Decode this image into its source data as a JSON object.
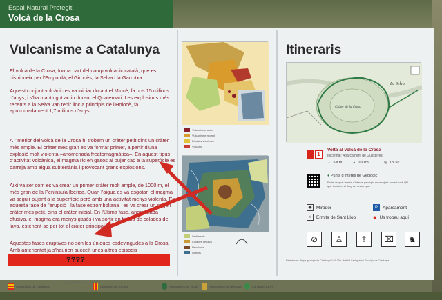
{
  "header": {
    "subtitle": "Espai Natural Protegit",
    "title": "Volcà de la Crosa"
  },
  "left": {
    "heading": "Vulcanisme a Catalunya",
    "p1": "El volcà de la Crosa, forma part del camp volcànic català, que es distribueix per l'Empordà, el Gironès, la Selva i la Garrotxa.",
    "p2": "Aquest conjunt volcànic es va iniciar durant el Miocè, fa uns 15 milions d'anys, i s'ha mantingut actiu durant el Quaternari. Les explosions més recents a la Selva van tenir lloc a principis de l'Holocè, fa aproximadament 1,7 milions d'anys.",
    "p3": "A l'interior del volcà de la Crosa hi trobem un cràter petit dins un cràter més ample. El cràter més gran es va formar primer, a partir d'una explosió molt violenta –anomenada freatomagmàtica–. En aquest tipus d'activitat volcànica, el magma ric en gasos al pujar cap a la superfície es barreja amb aigua subterrània i provocant grans explosions.",
    "p4": "Així va ser com es va crear un primer cràter molt ample, de 1000 m, el més gran de la Península Ibèrica. Quan l'aigua es va esgotar, el magma va seguir pujant a la superfície però amb una activitat menys violenta. En aquesta fase de l'erupció –la fase estromboliana– es va crear un segon cràter més petit, dins el cràter inicial. En l'última fase, anomenada efusiva, el magma era menys gasós i va sortir en forma de colades de lava, estenent-se per tot el cràter principal.",
    "p5": "Aquestes fases eruptives no són les úniques esdevingudes a la Crosa. Amb anterioritat ja s'haurien succeït unes altres episodis",
    "redbar_text": "????"
  },
  "maps": {
    "legend1": [
      "Vulcanisme antic",
      "Vulcanisme recent",
      "Dipòsits volcànics",
      "Volcans"
    ],
    "legend2": [
      "Sediments",
      "Colades de lava",
      "Piroclasts",
      "Granits"
    ]
  },
  "right": {
    "heading": "Itineraris",
    "map_labels": [
      "La Selva",
      "Cràter de la Crosa"
    ],
    "route_number": "1",
    "route_title": "Volta al volcà de la Crosa",
    "route_sub": "Inici/final: Aparcament de Guilsterés",
    "stats": [
      "5 Km",
      "100 m",
      "1h 30'"
    ],
    "geo_label": "Punts d'Interès de Geològic",
    "geo_text": "Podeu seguir la ruta d'interès geològic escanejant aquest codi QR que trobareu al llarg del recorregut.",
    "poi": {
      "mirador": "Mirador",
      "ermita": "Ermita de Sant Llop",
      "aparcament": "Aparcament",
      "ubicacio": "Us trobeu aquí"
    },
    "refs": "Referències: Mapa geològic de Catalunya 1:50.000 · Institut Cartogràfic i Geològic de Catalunya"
  },
  "footer": {
    "logos": [
      "Generalitat de Catalunya",
      "Diputació de Girona",
      "Ajuntament de Vilobí",
      "Ajuntament de Bescanó",
      "Fundació Emys"
    ],
    "url": "www.generalitat.cat"
  },
  "colors": {
    "green_bar": "#2f6a3a",
    "body_text": "#8a1e2b",
    "red_bar": "#e1271d",
    "arrow": "#d12a23"
  }
}
